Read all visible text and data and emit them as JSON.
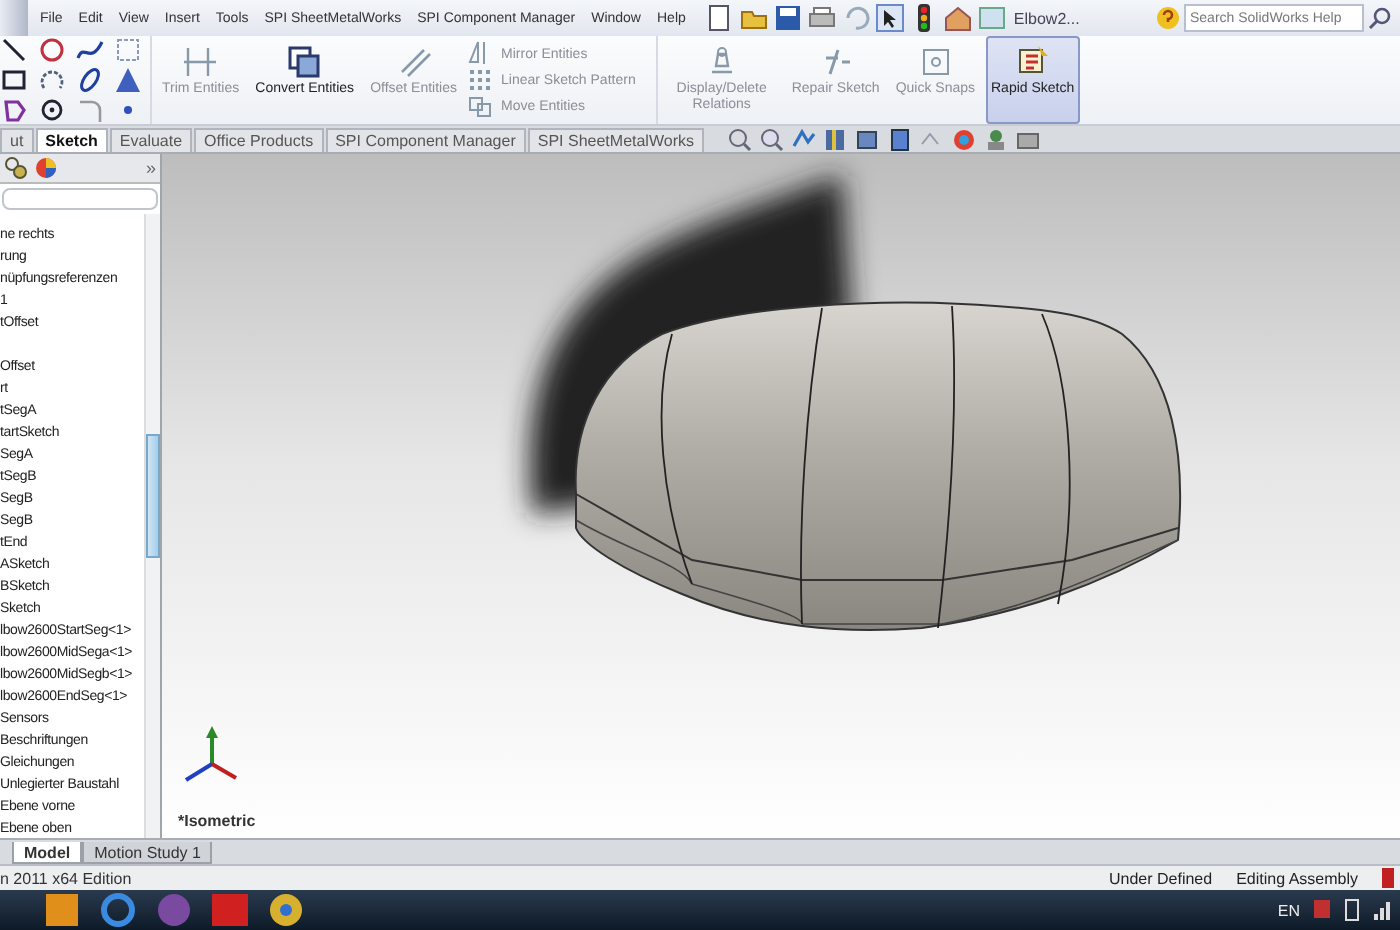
{
  "menu_bar": {
    "items": [
      "File",
      "Edit",
      "View",
      "Insert",
      "Tools",
      "SPI SheetMetalWorks",
      "SPI Component Manager",
      "Window",
      "Help"
    ],
    "document_title": "Elbow2...",
    "search": {
      "placeholder": "Search SolidWorks Help"
    }
  },
  "ribbon": {
    "buttons": [
      {
        "kind": "large",
        "label": "Trim Entities",
        "disabled": true,
        "on": false
      },
      {
        "kind": "large",
        "label": "Convert Entities",
        "disabled": false,
        "on": false
      },
      {
        "kind": "large",
        "label": "Offset Entities",
        "disabled": true,
        "on": false
      },
      {
        "kind": "stack",
        "items": [
          {
            "label": "Mirror Entities",
            "disabled": true
          },
          {
            "label": "Linear Sketch Pattern",
            "disabled": true
          },
          {
            "label": "Move Entities",
            "disabled": true
          }
        ]
      },
      {
        "kind": "large",
        "label": "Display/Delete Relations",
        "disabled": true,
        "on": false
      },
      {
        "kind": "large",
        "label": "Repair Sketch",
        "disabled": true,
        "on": false
      },
      {
        "kind": "large",
        "label": "Quick Snaps",
        "disabled": true,
        "on": false
      },
      {
        "kind": "large",
        "label": "Rapid Sketch",
        "disabled": false,
        "on": true
      }
    ]
  },
  "tabs": [
    {
      "label": "ut",
      "selected": false
    },
    {
      "label": "Sketch",
      "selected": true
    },
    {
      "label": "Evaluate",
      "selected": false
    },
    {
      "label": "Office Products",
      "selected": false
    },
    {
      "label": "SPI Component Manager",
      "selected": false
    },
    {
      "label": "SPI SheetMetalWorks",
      "selected": false
    }
  ],
  "feature_tree": {
    "collapse_glyph": "»",
    "items": [
      "ne rechts",
      "rung",
      "nüpfungsreferenzen",
      "1",
      "tOffset",
      "Offset",
      "rt",
      "tSegA",
      "tartSketch",
      "SegA",
      "tSegB",
      "SegB",
      "SegB",
      "tEnd",
      "ASketch",
      "BSketch",
      "Sketch",
      "lbow2600StartSeg<1>",
      "lbow2600MidSega<1>",
      "lbow2600MidSegb<1>",
      "lbow2600EndSeg<1>",
      "Sensors",
      "Beschriftungen",
      "Gleichungen",
      "Unlegierter Baustahl",
      "Ebene vorne",
      "Ebene oben"
    ]
  },
  "viewport": {
    "view_label": "*Isometric"
  },
  "bottom_tabs": [
    {
      "label": "Model",
      "selected": true
    },
    {
      "label": "Motion Study 1",
      "selected": false
    }
  ],
  "status_bar": {
    "edition": "n 2011 x64 Edition",
    "sketch_state": "Under Defined",
    "mode": "Editing Assembly"
  },
  "taskbar": {
    "language": "EN"
  }
}
